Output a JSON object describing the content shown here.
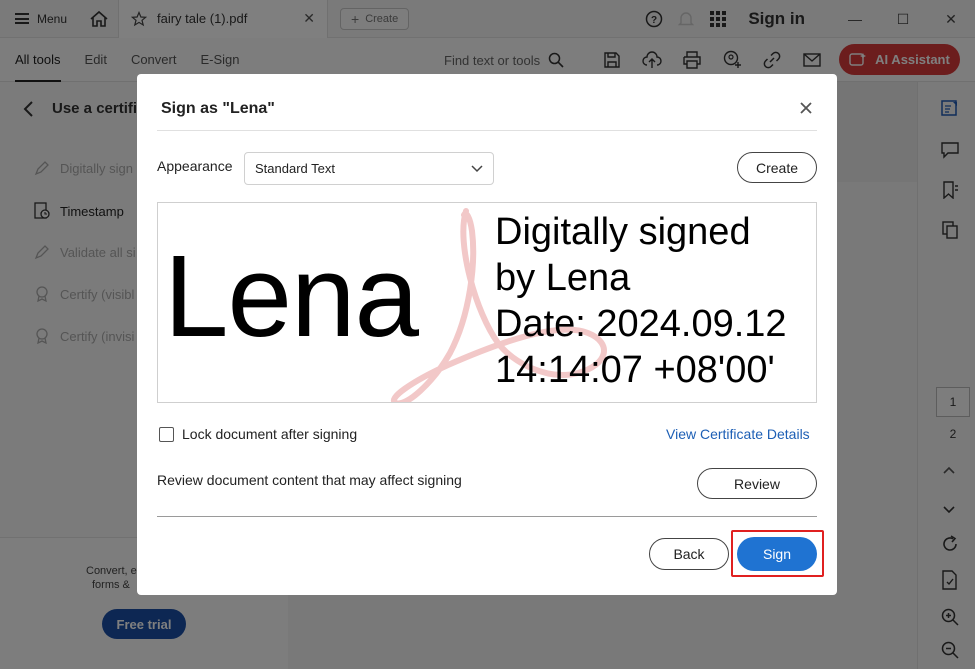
{
  "titlebar": {
    "menu_label": "Menu",
    "tab_name": "fairy tale (1).pdf",
    "tab_close": "✕",
    "create_label": "Create",
    "sign_in_label": "Sign in",
    "minimize": "—",
    "maximize": "☐",
    "close": "✕"
  },
  "toolbar": {
    "tabs": [
      "All tools",
      "Edit",
      "Convert",
      "E-Sign"
    ],
    "find_placeholder": "Find text or tools",
    "ai_assistant_label": "AI Assistant"
  },
  "left_panel": {
    "header": "Use a certifi",
    "items": [
      "Digitally sign",
      "Timestamp",
      "Validate all si",
      "Certify (visibl",
      "Certify (invisi"
    ],
    "promo_line1": "Convert, e",
    "promo_line2": "forms & ",
    "free_trial_label": "Free trial"
  },
  "right_rail": {
    "page_current": "1",
    "page_next": "2"
  },
  "dialog": {
    "title": "Sign as \"Lena\"",
    "appearance_label": "Appearance",
    "appearance_value": "Standard Text",
    "create_label": "Create",
    "preview": {
      "name": "Lena",
      "sig_line1": "Digitally signed",
      "sig_line2": "by Lena",
      "sig_line3": "Date: 2024.09.12",
      "sig_line4": "14:14:07 +08'00'"
    },
    "lock_label": "Lock document after signing",
    "lock_checked": false,
    "view_cert_label": "View Certificate Details",
    "review_text": "Review document content that may affect signing",
    "review_label": "Review",
    "back_label": "Back",
    "sign_label": "Sign"
  },
  "colors": {
    "ai_button": "#d93a3a",
    "sign_button": "#1f73d2",
    "highlight": "#e02020",
    "link": "#1d5fb5",
    "free_trial": "#1b4ea6"
  }
}
